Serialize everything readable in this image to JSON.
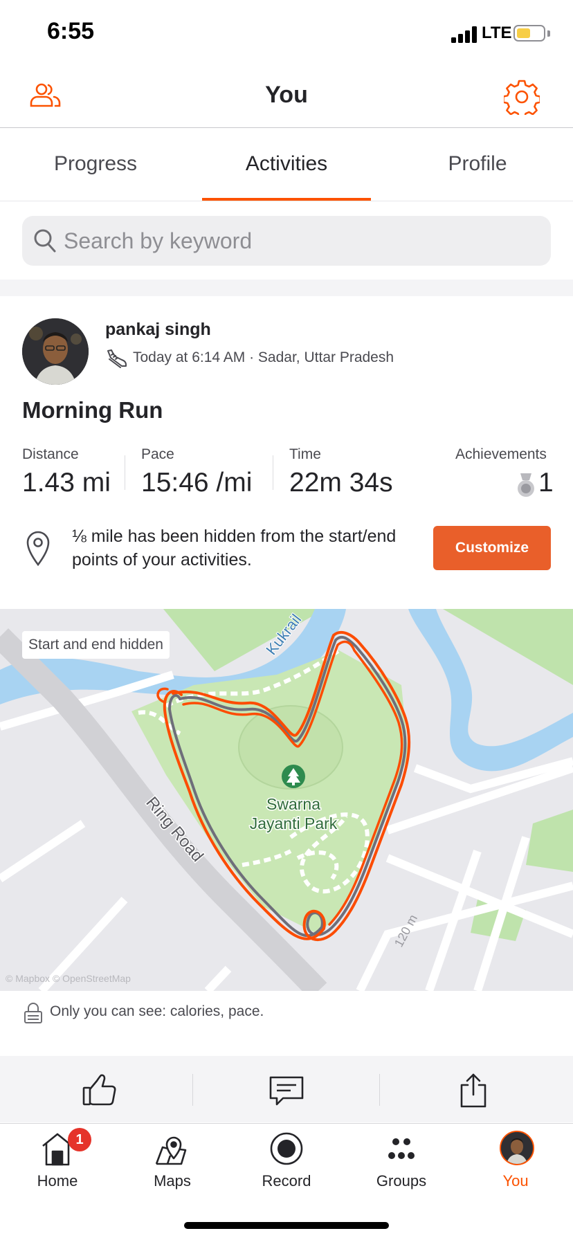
{
  "status_bar": {
    "time": "6:55",
    "network": "LTE",
    "battery_level": 0.46
  },
  "header": {
    "title": "You"
  },
  "tabs": [
    {
      "label": "Progress",
      "active": false
    },
    {
      "label": "Activities",
      "active": true
    },
    {
      "label": "Profile",
      "active": false
    }
  ],
  "search": {
    "placeholder": "Search by keyword",
    "value": ""
  },
  "activity": {
    "athlete_name": "pankaj singh",
    "meta": "Today at 6:14 AM · Sadar, Uttar Pradesh",
    "title": "Morning Run",
    "stats": {
      "distance": {
        "label": "Distance",
        "value": "1.43 mi"
      },
      "pace": {
        "label": "Pace",
        "value": "15:46 /mi"
      },
      "time": {
        "label": "Time",
        "value": "22m 34s"
      },
      "achievements": {
        "label": "Achievements",
        "value": "1"
      }
    },
    "privacy_notice": "⅛ mile has been hidden from the start/end points of your activities.",
    "customize_label": "Customize",
    "map": {
      "badge": "Start and end hidden",
      "park_label_line1": "Swarna",
      "park_label_line2": "Jayanti Park",
      "road_label": "Ring Road",
      "river_label": "Kukrail",
      "road_small_label": "120 m",
      "attribution": "© Mapbox © OpenStreetMap"
    },
    "visibility_note": "Only you can see: calories, pace."
  },
  "bottom_nav": [
    {
      "label": "Home",
      "icon": "home-icon",
      "badge": "1",
      "active": false
    },
    {
      "label": "Maps",
      "icon": "maps-icon",
      "active": false
    },
    {
      "label": "Record",
      "icon": "record-icon",
      "active": false
    },
    {
      "label": "Groups",
      "icon": "groups-icon",
      "active": false
    },
    {
      "label": "You",
      "icon": "avatar",
      "active": true
    }
  ],
  "colors": {
    "accent": "#fc5200",
    "button": "#e95f2a",
    "route": "#fc4c02",
    "park": "#c9e7b4",
    "water": "#a8d3f2"
  }
}
